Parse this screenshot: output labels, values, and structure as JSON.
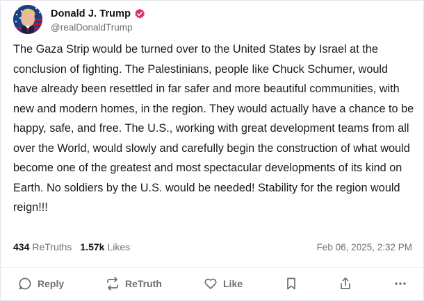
{
  "post": {
    "author": {
      "display_name": "Donald J. Trump",
      "handle": "@realDonaldTrump",
      "verified": true,
      "verified_color": "#d8366a",
      "avatar_icon": "avatar-portrait-flag"
    },
    "text": "The Gaza Strip would be turned over to the United States by Israel at the conclusion of fighting. The Palestinians, people like Chuck Schumer, would have already been resettled in far safer and more beautiful communities, with new and modern homes, in the region. They would actually have a chance to be happy, safe, and free. The U.S., working with great development teams from all over the World, would slowly and carefully begin the construction of what would become one of the greatest and most spectacular developments of its kind on Earth. No soldiers by the U.S. would be needed! Stability for the region would reign!!!",
    "stats": {
      "retruths_count": "434",
      "retruths_label": "ReTruths",
      "likes_count": "1.57k",
      "likes_label": "Likes"
    },
    "timestamp": "Feb 06, 2025, 2:32 PM"
  },
  "actions": {
    "reply": {
      "label": "Reply",
      "icon": "reply-icon"
    },
    "retruth": {
      "label": "ReTruth",
      "icon": "retruth-icon"
    },
    "like": {
      "label": "Like",
      "icon": "heart-icon"
    },
    "bookmark": {
      "icon": "bookmark-icon"
    },
    "share": {
      "icon": "share-icon"
    },
    "more": {
      "icon": "more-icon"
    }
  },
  "colors": {
    "text_primary": "#111111",
    "text_secondary": "#6b6f76",
    "border": "#e3e5ea"
  }
}
